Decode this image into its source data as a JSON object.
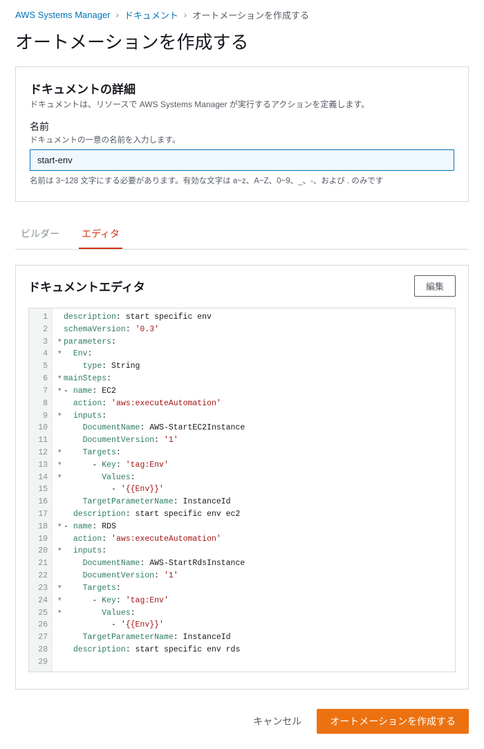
{
  "breadcrumb": {
    "service": "AWS Systems Manager",
    "section": "ドキュメント",
    "current": "オートメーションを作成する"
  },
  "page_title": "オートメーションを作成する",
  "details_panel": {
    "heading": "ドキュメントの詳細",
    "desc": "ドキュメントは、リソースで AWS Systems Manager が実行するアクションを定義します。",
    "name_label": "名前",
    "name_sub": "ドキュメントの一意の名前を入力します。",
    "name_value": "start-env",
    "name_help": "名前は 3~128 文字にする必要があります。有効な文字は a~z、A~Z、0~9、_、-、および . のみです"
  },
  "tabs": {
    "builder": "ビルダー",
    "editor": "エディタ"
  },
  "editor_panel": {
    "heading": "ドキュメントエディタ",
    "edit_button": "編集"
  },
  "code_lines": [
    {
      "n": 1,
      "f": "",
      "t": [
        [
          "k",
          "description"
        ],
        [
          "d",
          ": start specific env"
        ]
      ]
    },
    {
      "n": 2,
      "f": "",
      "t": [
        [
          "k",
          "schemaVersion"
        ],
        [
          "d",
          ": "
        ],
        [
          "s",
          "'0.3'"
        ]
      ]
    },
    {
      "n": 3,
      "f": "▾",
      "t": [
        [
          "k",
          "parameters"
        ],
        [
          "d",
          ":"
        ]
      ]
    },
    {
      "n": 4,
      "f": "▾",
      "t": [
        [
          "d",
          "  "
        ],
        [
          "k",
          "Env"
        ],
        [
          "d",
          ":"
        ]
      ]
    },
    {
      "n": 5,
      "f": "",
      "t": [
        [
          "d",
          "    "
        ],
        [
          "k",
          "type"
        ],
        [
          "d",
          ": String"
        ]
      ]
    },
    {
      "n": 6,
      "f": "▾",
      "t": [
        [
          "k",
          "mainSteps"
        ],
        [
          "d",
          ":"
        ]
      ]
    },
    {
      "n": 7,
      "f": "▾",
      "t": [
        [
          "d",
          "- "
        ],
        [
          "k",
          "name"
        ],
        [
          "d",
          ": EC2"
        ]
      ]
    },
    {
      "n": 8,
      "f": "",
      "t": [
        [
          "d",
          "  "
        ],
        [
          "k",
          "action"
        ],
        [
          "d",
          ": "
        ],
        [
          "s",
          "'aws:executeAutomation'"
        ]
      ]
    },
    {
      "n": 9,
      "f": "▾",
      "t": [
        [
          "d",
          "  "
        ],
        [
          "k",
          "inputs"
        ],
        [
          "d",
          ":"
        ]
      ]
    },
    {
      "n": 10,
      "f": "",
      "t": [
        [
          "d",
          "    "
        ],
        [
          "k",
          "DocumentName"
        ],
        [
          "d",
          ": AWS-StartEC2Instance"
        ]
      ]
    },
    {
      "n": 11,
      "f": "",
      "t": [
        [
          "d",
          "    "
        ],
        [
          "k",
          "DocumentVersion"
        ],
        [
          "d",
          ": "
        ],
        [
          "s",
          "'1'"
        ]
      ]
    },
    {
      "n": 12,
      "f": "▾",
      "t": [
        [
          "d",
          "    "
        ],
        [
          "k",
          "Targets"
        ],
        [
          "d",
          ":"
        ]
      ]
    },
    {
      "n": 13,
      "f": "▾",
      "t": [
        [
          "d",
          "      - "
        ],
        [
          "k",
          "Key"
        ],
        [
          "d",
          ": "
        ],
        [
          "s",
          "'tag:Env'"
        ]
      ]
    },
    {
      "n": 14,
      "f": "▾",
      "t": [
        [
          "d",
          "        "
        ],
        [
          "k",
          "Values"
        ],
        [
          "d",
          ":"
        ]
      ]
    },
    {
      "n": 15,
      "f": "",
      "t": [
        [
          "d",
          "          - "
        ],
        [
          "s",
          "'{{Env}}'"
        ]
      ]
    },
    {
      "n": 16,
      "f": "",
      "t": [
        [
          "d",
          "    "
        ],
        [
          "k",
          "TargetParameterName"
        ],
        [
          "d",
          ": InstanceId"
        ]
      ]
    },
    {
      "n": 17,
      "f": "",
      "t": [
        [
          "d",
          "  "
        ],
        [
          "k",
          "description"
        ],
        [
          "d",
          ": start specific env ec2"
        ]
      ]
    },
    {
      "n": 18,
      "f": "▾",
      "t": [
        [
          "d",
          "- "
        ],
        [
          "k",
          "name"
        ],
        [
          "d",
          ": RDS"
        ]
      ]
    },
    {
      "n": 19,
      "f": "",
      "t": [
        [
          "d",
          "  "
        ],
        [
          "k",
          "action"
        ],
        [
          "d",
          ": "
        ],
        [
          "s",
          "'aws:executeAutomation'"
        ]
      ]
    },
    {
      "n": 20,
      "f": "▾",
      "t": [
        [
          "d",
          "  "
        ],
        [
          "k",
          "inputs"
        ],
        [
          "d",
          ":"
        ]
      ]
    },
    {
      "n": 21,
      "f": "",
      "t": [
        [
          "d",
          "    "
        ],
        [
          "k",
          "DocumentName"
        ],
        [
          "d",
          ": AWS-StartRdsInstance"
        ]
      ]
    },
    {
      "n": 22,
      "f": "",
      "t": [
        [
          "d",
          "    "
        ],
        [
          "k",
          "DocumentVersion"
        ],
        [
          "d",
          ": "
        ],
        [
          "s",
          "'1'"
        ]
      ]
    },
    {
      "n": 23,
      "f": "▾",
      "t": [
        [
          "d",
          "    "
        ],
        [
          "k",
          "Targets"
        ],
        [
          "d",
          ":"
        ]
      ]
    },
    {
      "n": 24,
      "f": "▾",
      "t": [
        [
          "d",
          "      - "
        ],
        [
          "k",
          "Key"
        ],
        [
          "d",
          ": "
        ],
        [
          "s",
          "'tag:Env'"
        ]
      ]
    },
    {
      "n": 25,
      "f": "▾",
      "t": [
        [
          "d",
          "        "
        ],
        [
          "k",
          "Values"
        ],
        [
          "d",
          ":"
        ]
      ]
    },
    {
      "n": 26,
      "f": "",
      "t": [
        [
          "d",
          "          - "
        ],
        [
          "s",
          "'{{Env}}'"
        ]
      ]
    },
    {
      "n": 27,
      "f": "",
      "t": [
        [
          "d",
          "    "
        ],
        [
          "k",
          "TargetParameterName"
        ],
        [
          "d",
          ": InstanceId"
        ]
      ]
    },
    {
      "n": 28,
      "f": "",
      "t": [
        [
          "d",
          "  "
        ],
        [
          "k",
          "description"
        ],
        [
          "d",
          ": start specific env rds"
        ]
      ]
    },
    {
      "n": 29,
      "f": "",
      "t": []
    }
  ],
  "footer": {
    "cancel": "キャンセル",
    "create": "オートメーションを作成する"
  }
}
